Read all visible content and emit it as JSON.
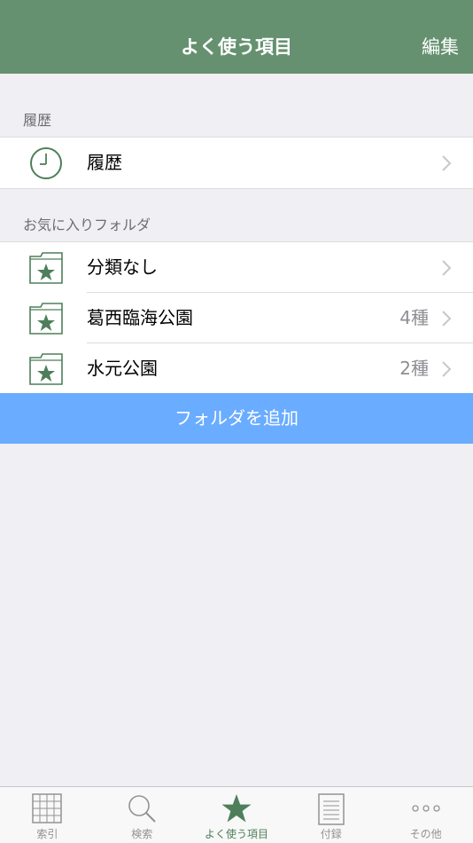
{
  "navbar": {
    "title": "よく使う項目",
    "edit_label": "編集"
  },
  "history_section": {
    "header": "履歴",
    "items": [
      {
        "label": "履歴",
        "icon": "clock-icon"
      }
    ]
  },
  "favorites_section": {
    "header": "お気に入りフォルダ",
    "items": [
      {
        "label": "分類なし",
        "count": "",
        "icon": "star-folder-icon"
      },
      {
        "label": "葛西臨海公園",
        "count": "4種",
        "icon": "star-folder-icon"
      },
      {
        "label": "水元公園",
        "count": "2種",
        "icon": "star-folder-icon"
      }
    ]
  },
  "add_folder_label": "フォルダを追加",
  "tabbar": {
    "tabs": [
      {
        "label": "索引",
        "icon": "grid-icon"
      },
      {
        "label": "検索",
        "icon": "magnifier-icon"
      },
      {
        "label": "よく使う項目",
        "icon": "star-icon",
        "active": true
      },
      {
        "label": "付録",
        "icon": "document-icon"
      },
      {
        "label": "その他",
        "icon": "more-dots-icon"
      }
    ]
  },
  "colors": {
    "navbar": "#659170",
    "accent_green": "#4e7f5a",
    "add_button": "#6aacff",
    "background": "#efeff4"
  }
}
